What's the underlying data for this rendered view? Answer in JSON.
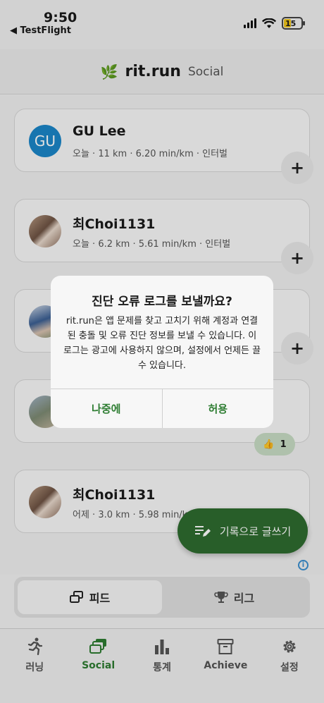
{
  "status_bar": {
    "time": "9:50",
    "back_label": "◀ TestFlight",
    "battery_level": "15"
  },
  "header": {
    "logo": "rit.run",
    "subtitle": "Social"
  },
  "feed": {
    "items": [
      {
        "initials": "GU",
        "name": "GU Lee",
        "stats": "오늘 · 11 km · 6.20 min/km · 인터벌"
      },
      {
        "name": "최Choi1131",
        "stats": "오늘 · 6.2 km · 5.61 min/km · 인터벌"
      },
      {
        "name": "",
        "stats": ""
      },
      {
        "name": "",
        "stats": ""
      },
      {
        "name": "최Choi1131",
        "stats": "어제 · 3.0 km · 5.98 min/km · 인터벌"
      }
    ],
    "reaction_count": "1"
  },
  "dialog": {
    "title": "진단 오류 로그를 보낼까요?",
    "message": "rit.run은 앱 문제를 찾고 고치기 위해 계정과 연결된 충돌 및 오류 진단 정보를 보낼 수 있습니다. 이 로그는 광고에 사용하지 않으며, 설정에서 언제든 끌 수 있습니다.",
    "later_label": "나중에",
    "allow_label": "허용"
  },
  "fab": {
    "label": "기록으로 글쓰기"
  },
  "segment": {
    "feed_label": "피드",
    "league_label": "리그"
  },
  "tabs": [
    {
      "label": "러닝",
      "icon": "runner-icon"
    },
    {
      "label": "Social",
      "icon": "social-icon"
    },
    {
      "label": "통계",
      "icon": "stats-icon"
    },
    {
      "label": "Achieve",
      "icon": "archive-icon"
    },
    {
      "label": "설정",
      "icon": "gear-icon"
    }
  ],
  "colors": {
    "accent": "#2e7d32",
    "fab": "#2e6b2f",
    "avatar_blue": "#1b86c8"
  }
}
